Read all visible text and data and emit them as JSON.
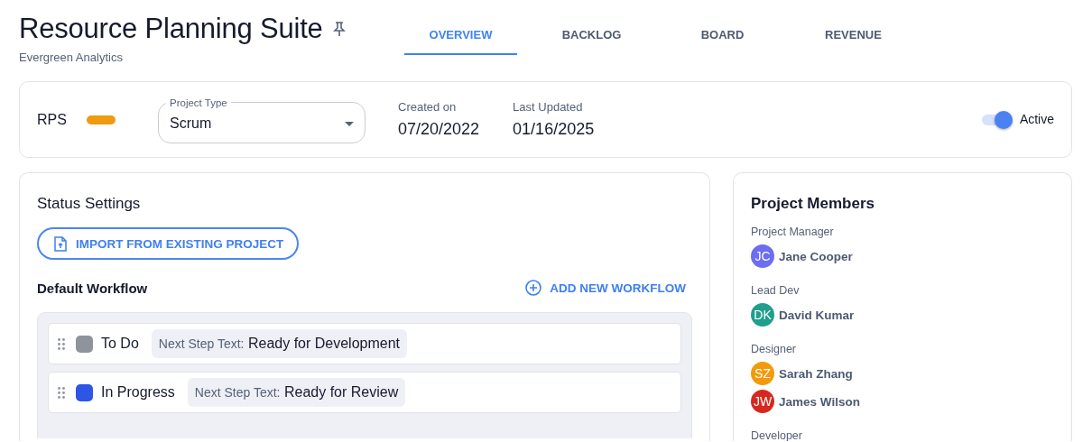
{
  "header": {
    "title": "Resource Planning Suite",
    "pinned": true,
    "subtitle": "Evergreen Analytics"
  },
  "tabs": [
    {
      "label": "OVERVIEW",
      "selected": true
    },
    {
      "label": "BACKLOG",
      "selected": false
    },
    {
      "label": "BOARD",
      "selected": false
    },
    {
      "label": "REVENUE",
      "selected": false
    }
  ],
  "project_info": {
    "key": "RPS",
    "project_type": {
      "label": "Project Type",
      "value": "Scrum"
    },
    "dates": [
      {
        "label": "Created on",
        "value": "07/20/2022"
      },
      {
        "label": "Last Updated",
        "value": "01/16/2025"
      }
    ],
    "active": {
      "label": "Active",
      "on": true
    }
  },
  "status_settings": {
    "title": "Status Settings",
    "import_button": "IMPORT FROM EXISTING PROJECT",
    "workflow_title": "Default Workflow",
    "add_button": "ADD NEW WORKFLOW",
    "statuses": [
      {
        "name": "To Do",
        "color": "#8e939c",
        "next_step_label": "Next Step Text:",
        "next_step": "Ready for Development"
      },
      {
        "name": "In Progress",
        "color": "#2d55e6",
        "next_step_label": "Next Step Text:",
        "next_step": "Ready for Review"
      }
    ]
  },
  "members": {
    "title": "Project Members",
    "roles": [
      {
        "role": "Project Manager",
        "people": [
          {
            "initials": "JC",
            "name": "Jane Cooper",
            "color": "#6b6ef0"
          }
        ]
      },
      {
        "role": "Lead Dev",
        "people": [
          {
            "initials": "DK",
            "name": "David Kumar",
            "color": "#209e8e"
          }
        ]
      },
      {
        "role": "Designer",
        "people": [
          {
            "initials": "SZ",
            "name": "Sarah Zhang",
            "color": "#f39a0c"
          },
          {
            "initials": "JW",
            "name": "James Wilson",
            "color": "#d5291f"
          }
        ]
      },
      {
        "role": "Developer"
      }
    ]
  }
}
